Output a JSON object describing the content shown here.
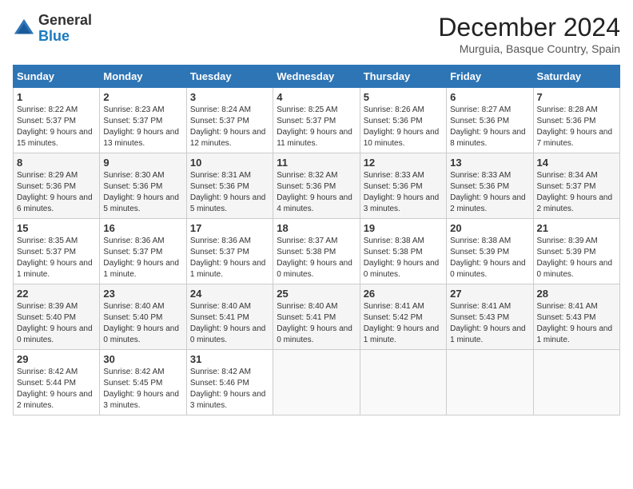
{
  "header": {
    "logo_general": "General",
    "logo_blue": "Blue",
    "month_title": "December 2024",
    "location": "Murguia, Basque Country, Spain"
  },
  "days_of_week": [
    "Sunday",
    "Monday",
    "Tuesday",
    "Wednesday",
    "Thursday",
    "Friday",
    "Saturday"
  ],
  "weeks": [
    [
      {
        "day": 1,
        "sunrise": "8:22 AM",
        "sunset": "5:37 PM",
        "daylight": "9 hours and 15 minutes."
      },
      {
        "day": 2,
        "sunrise": "8:23 AM",
        "sunset": "5:37 PM",
        "daylight": "9 hours and 13 minutes."
      },
      {
        "day": 3,
        "sunrise": "8:24 AM",
        "sunset": "5:37 PM",
        "daylight": "9 hours and 12 minutes."
      },
      {
        "day": 4,
        "sunrise": "8:25 AM",
        "sunset": "5:37 PM",
        "daylight": "9 hours and 11 minutes."
      },
      {
        "day": 5,
        "sunrise": "8:26 AM",
        "sunset": "5:36 PM",
        "daylight": "9 hours and 10 minutes."
      },
      {
        "day": 6,
        "sunrise": "8:27 AM",
        "sunset": "5:36 PM",
        "daylight": "9 hours and 8 minutes."
      },
      {
        "day": 7,
        "sunrise": "8:28 AM",
        "sunset": "5:36 PM",
        "daylight": "9 hours and 7 minutes."
      }
    ],
    [
      {
        "day": 8,
        "sunrise": "8:29 AM",
        "sunset": "5:36 PM",
        "daylight": "9 hours and 6 minutes."
      },
      {
        "day": 9,
        "sunrise": "8:30 AM",
        "sunset": "5:36 PM",
        "daylight": "9 hours and 5 minutes."
      },
      {
        "day": 10,
        "sunrise": "8:31 AM",
        "sunset": "5:36 PM",
        "daylight": "9 hours and 5 minutes."
      },
      {
        "day": 11,
        "sunrise": "8:32 AM",
        "sunset": "5:36 PM",
        "daylight": "9 hours and 4 minutes."
      },
      {
        "day": 12,
        "sunrise": "8:33 AM",
        "sunset": "5:36 PM",
        "daylight": "9 hours and 3 minutes."
      },
      {
        "day": 13,
        "sunrise": "8:33 AM",
        "sunset": "5:36 PM",
        "daylight": "9 hours and 2 minutes."
      },
      {
        "day": 14,
        "sunrise": "8:34 AM",
        "sunset": "5:37 PM",
        "daylight": "9 hours and 2 minutes."
      }
    ],
    [
      {
        "day": 15,
        "sunrise": "8:35 AM",
        "sunset": "5:37 PM",
        "daylight": "9 hours and 1 minute."
      },
      {
        "day": 16,
        "sunrise": "8:36 AM",
        "sunset": "5:37 PM",
        "daylight": "9 hours and 1 minute."
      },
      {
        "day": 17,
        "sunrise": "8:36 AM",
        "sunset": "5:37 PM",
        "daylight": "9 hours and 1 minute."
      },
      {
        "day": 18,
        "sunrise": "8:37 AM",
        "sunset": "5:38 PM",
        "daylight": "9 hours and 0 minutes."
      },
      {
        "day": 19,
        "sunrise": "8:38 AM",
        "sunset": "5:38 PM",
        "daylight": "9 hours and 0 minutes."
      },
      {
        "day": 20,
        "sunrise": "8:38 AM",
        "sunset": "5:39 PM",
        "daylight": "9 hours and 0 minutes."
      },
      {
        "day": 21,
        "sunrise": "8:39 AM",
        "sunset": "5:39 PM",
        "daylight": "9 hours and 0 minutes."
      }
    ],
    [
      {
        "day": 22,
        "sunrise": "8:39 AM",
        "sunset": "5:40 PM",
        "daylight": "9 hours and 0 minutes."
      },
      {
        "day": 23,
        "sunrise": "8:40 AM",
        "sunset": "5:40 PM",
        "daylight": "9 hours and 0 minutes."
      },
      {
        "day": 24,
        "sunrise": "8:40 AM",
        "sunset": "5:41 PM",
        "daylight": "9 hours and 0 minutes."
      },
      {
        "day": 25,
        "sunrise": "8:40 AM",
        "sunset": "5:41 PM",
        "daylight": "9 hours and 0 minutes."
      },
      {
        "day": 26,
        "sunrise": "8:41 AM",
        "sunset": "5:42 PM",
        "daylight": "9 hours and 1 minute."
      },
      {
        "day": 27,
        "sunrise": "8:41 AM",
        "sunset": "5:43 PM",
        "daylight": "9 hours and 1 minute."
      },
      {
        "day": 28,
        "sunrise": "8:41 AM",
        "sunset": "5:43 PM",
        "daylight": "9 hours and 1 minute."
      }
    ],
    [
      {
        "day": 29,
        "sunrise": "8:42 AM",
        "sunset": "5:44 PM",
        "daylight": "9 hours and 2 minutes."
      },
      {
        "day": 30,
        "sunrise": "8:42 AM",
        "sunset": "5:45 PM",
        "daylight": "9 hours and 3 minutes."
      },
      {
        "day": 31,
        "sunrise": "8:42 AM",
        "sunset": "5:46 PM",
        "daylight": "9 hours and 3 minutes."
      },
      null,
      null,
      null,
      null
    ]
  ]
}
